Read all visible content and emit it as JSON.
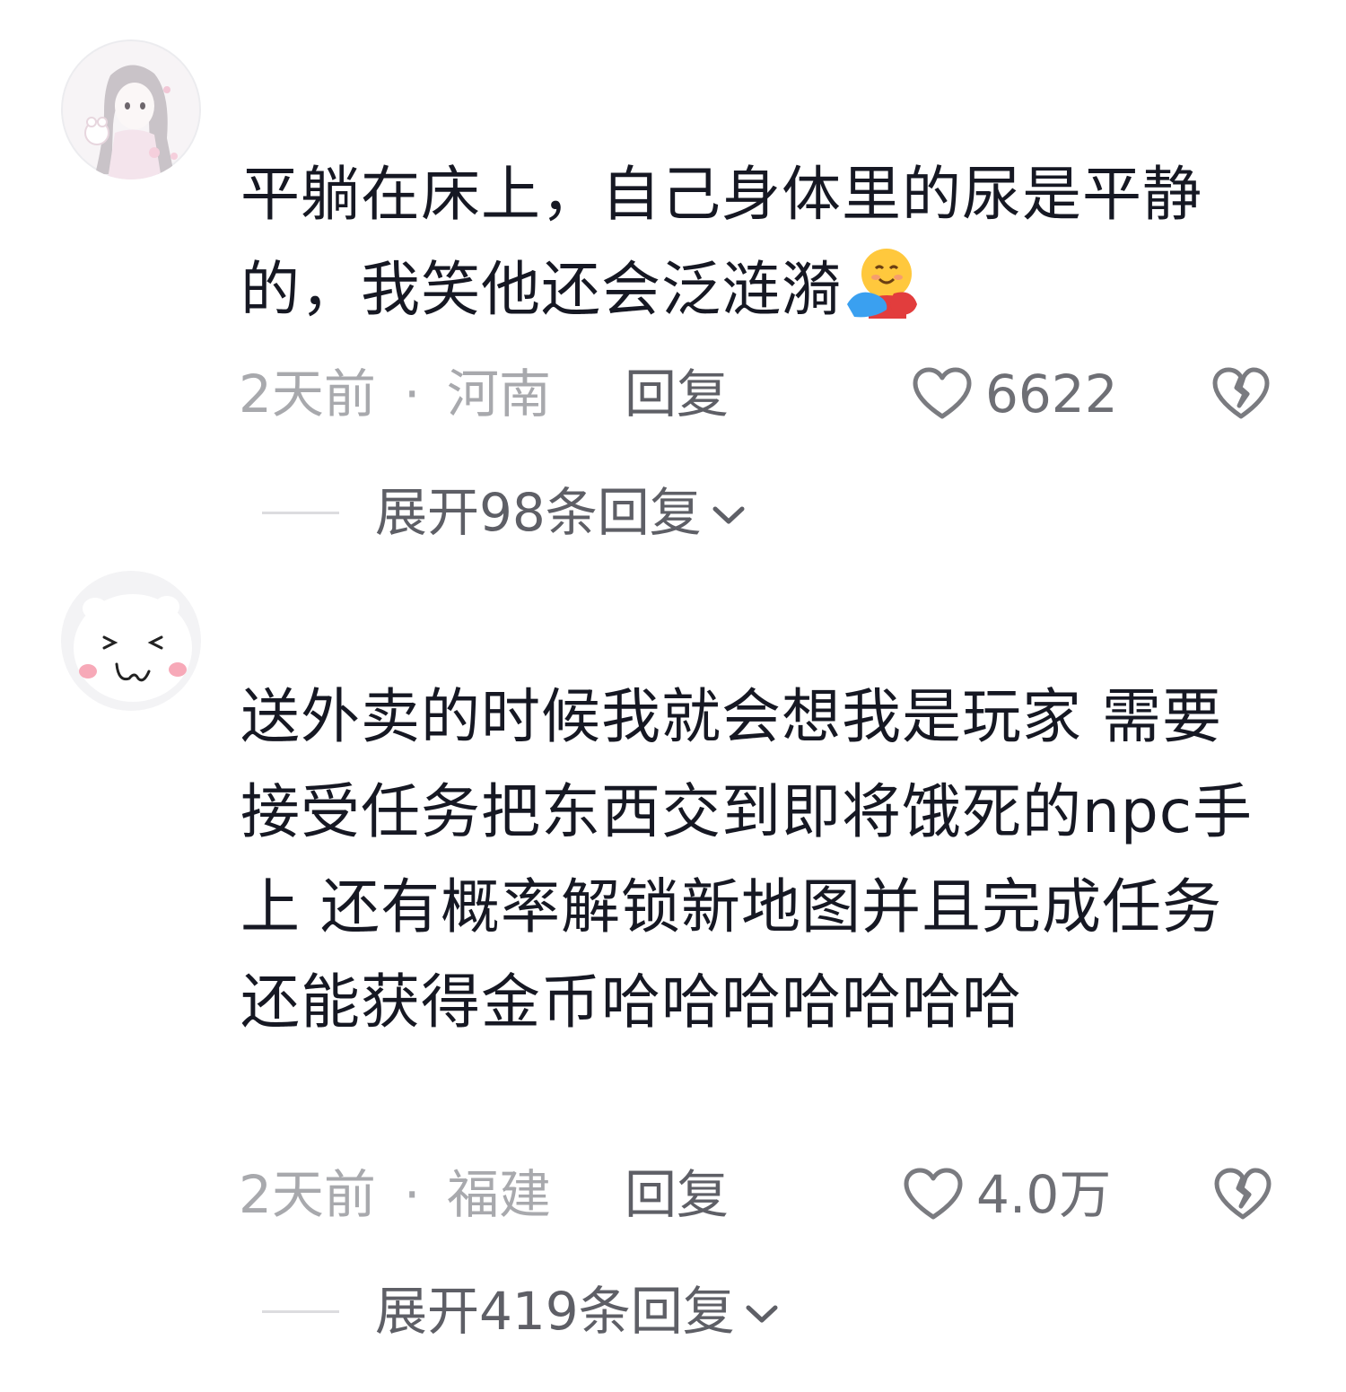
{
  "comments": [
    {
      "avatar_icon": "anime-girl-avatar",
      "text": "平躺在床上，自己身体里的尿是平静的，我笑他还会泛涟漪",
      "emoji": "hugging-face-emoji",
      "time": "2天前",
      "separator": "·",
      "location": "河南",
      "reply_label": "回复",
      "like_count": "6622",
      "expand_label": "展开98条回复"
    },
    {
      "avatar_icon": "white-hamster-avatar",
      "text": "送外卖的时候我就会想我是玩家 需要接受任务把东西交到即将饿死的npc手上 还有概率解锁新地图并且完成任务还能获得金币哈哈哈哈哈哈哈",
      "time": "2天前",
      "separator": "·",
      "location": "福建",
      "reply_label": "回复",
      "like_count": "4.0万",
      "expand_label": "展开419条回复"
    }
  ],
  "colors": {
    "primary_text": "#161823",
    "secondary_text": "#a8a9ad",
    "action_text": "#5e5f66",
    "divider": "#dcdcdf"
  }
}
